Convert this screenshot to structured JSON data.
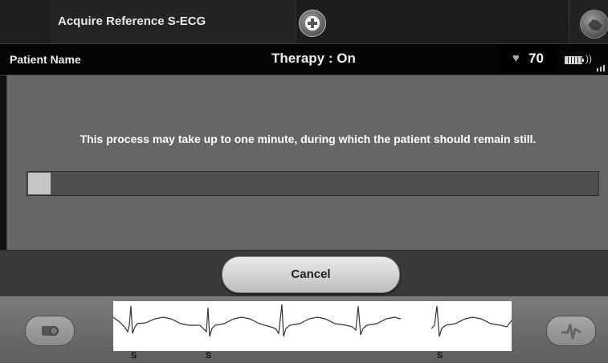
{
  "header": {
    "title": "Acquire Reference S-ECG",
    "add_icon": "plus-circle-icon",
    "shock_icon": "hand-icon"
  },
  "status": {
    "patient_name": "Patient Name",
    "therapy": "Therapy : On",
    "heart_rate": "70",
    "heart_icon": "heart-icon",
    "battery_icon": "battery-icon",
    "telemetry_icon": "wireless-icon",
    "signal_icon": "signal-bars-icon"
  },
  "main": {
    "message": "This process may take up to one minute, during which the patient should remain still.",
    "progress_fraction": 0.04
  },
  "actions": {
    "cancel_label": "Cancel"
  },
  "ecg": {
    "left_button_icon": "camera-icon",
    "right_button_icon": "ecg-marker-icon",
    "markers": [
      "S",
      "S",
      "S"
    ]
  },
  "colors": {
    "background": "#111111",
    "panel": "#666666",
    "progress_fill": "#c4c4c4"
  }
}
